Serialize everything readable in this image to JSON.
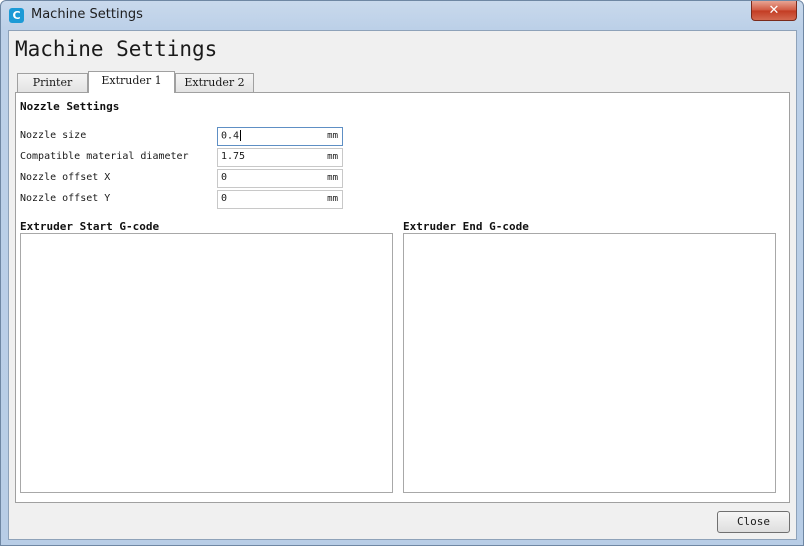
{
  "window": {
    "title": "Machine Settings",
    "app_icon_glyph": "C",
    "close_glyph": "✕"
  },
  "page_title": "Machine Settings",
  "tabs": [
    {
      "label": "Printer",
      "active": false
    },
    {
      "label": "Extruder 1",
      "active": true
    },
    {
      "label": "Extruder 2",
      "active": false
    }
  ],
  "nozzle": {
    "section_title": "Nozzle Settings",
    "fields": [
      {
        "label": "Nozzle size",
        "value": "0.4",
        "unit": "mm"
      },
      {
        "label": "Compatible material diameter",
        "value": "1.75",
        "unit": "mm"
      },
      {
        "label": "Nozzle offset X",
        "value": "0",
        "unit": "mm"
      },
      {
        "label": "Nozzle offset Y",
        "value": "0",
        "unit": "mm"
      }
    ]
  },
  "gcode": {
    "start_title": "Extruder Start G-code",
    "start_value": "",
    "end_title": "Extruder End G-code",
    "end_value": ""
  },
  "footer": {
    "close_label": "Close"
  },
  "colors": {
    "app_icon": "#1c9ad6",
    "title_close_button": "#c23b22",
    "focused_field_border": "#5e8fc4"
  }
}
